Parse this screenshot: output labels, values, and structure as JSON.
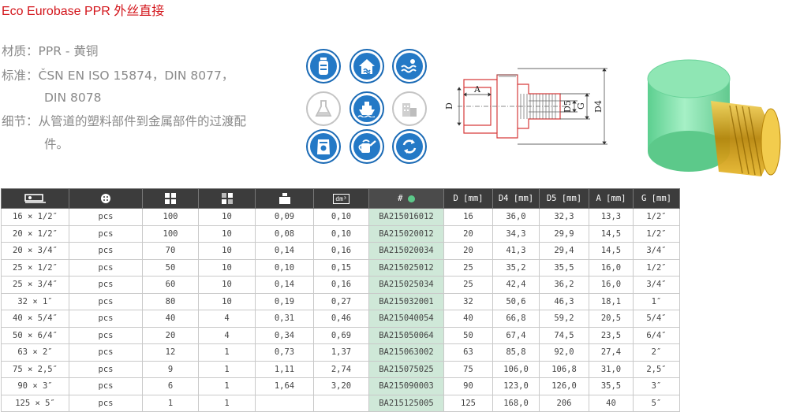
{
  "title": "Eco Eurobase PPR 外丝直接",
  "spec": {
    "material_label": "材质：",
    "material_value": "PPR - 黄铜",
    "standard_label": "标准：",
    "standard_value_1": "ČSN EN ISO 15874，DIN 8077，",
    "standard_value_2": "DIN 8078",
    "detail_label": "细节：",
    "detail_value_1": "从管道的塑料部件到金属部件的过渡配",
    "detail_value_2": "件。"
  },
  "application_icons": [
    {
      "name": "drinking-water-bottle-icon",
      "active": true
    },
    {
      "name": "house-heating-icon",
      "active": true
    },
    {
      "name": "swimming-pool-icon",
      "active": true
    },
    {
      "name": "chemistry-flask-icon",
      "active": false
    },
    {
      "name": "ship-icon",
      "active": true
    },
    {
      "name": "industrial-building-icon",
      "active": false
    },
    {
      "name": "fertilizer-bag-icon",
      "active": true
    },
    {
      "name": "watering-can-icon",
      "active": true
    },
    {
      "name": "recycling-arrows-icon",
      "active": true
    }
  ],
  "drawing_labels": {
    "d": "D",
    "a": "A",
    "d5": "D5",
    "g": "G",
    "d4": "D4"
  },
  "colors": {
    "title": "#d3151b",
    "header_bg": "#3c3c3c",
    "code_col": "#cfe8d8",
    "icon_blue": "#2479c6",
    "green_dot": "#5cc98a",
    "product_green": "#7ee0a8",
    "brass": "#d9a520"
  },
  "table": {
    "headers": [
      "size-icon",
      "pack-icon",
      "box-icon",
      "carton-icon",
      "weight-icon",
      "volume-icon",
      "#",
      "D [mm]",
      "D4 [mm]",
      "D5 [mm]",
      "A [mm]",
      "G [mm]"
    ],
    "header_text": {
      "code": "#",
      "d": "D [mm]",
      "d4": "D4 [mm]",
      "d5": "D5 [mm]",
      "a": "A [mm]",
      "g": "G [mm]",
      "dm3": "dm³"
    },
    "rows": [
      [
        "16 × 1/2″",
        "pcs",
        "100",
        "10",
        "0,09",
        "0,10",
        "BA215016012",
        "16",
        "36,0",
        "32,3",
        "13,3",
        "1/2″"
      ],
      [
        "20 × 1/2″",
        "pcs",
        "100",
        "10",
        "0,08",
        "0,10",
        "BA215020012",
        "20",
        "34,3",
        "29,9",
        "14,5",
        "1/2″"
      ],
      [
        "20 × 3/4″",
        "pcs",
        "70",
        "10",
        "0,14",
        "0,16",
        "BA215020034",
        "20",
        "41,3",
        "29,4",
        "14,5",
        "3/4″"
      ],
      [
        "25 × 1/2″",
        "pcs",
        "50",
        "10",
        "0,10",
        "0,15",
        "BA215025012",
        "25",
        "35,2",
        "35,5",
        "16,0",
        "1/2″"
      ],
      [
        "25 × 3/4″",
        "pcs",
        "60",
        "10",
        "0,14",
        "0,16",
        "BA215025034",
        "25",
        "42,4",
        "36,2",
        "16,0",
        "3/4″"
      ],
      [
        "32 × 1″",
        "pcs",
        "80",
        "10",
        "0,19",
        "0,27",
        "BA215032001",
        "32",
        "50,6",
        "46,3",
        "18,1",
        "1″"
      ],
      [
        "40 × 5/4″",
        "pcs",
        "40",
        "4",
        "0,31",
        "0,46",
        "BA215040054",
        "40",
        "66,8",
        "59,2",
        "20,5",
        "5/4″"
      ],
      [
        "50 × 6/4″",
        "pcs",
        "20",
        "4",
        "0,34",
        "0,69",
        "BA215050064",
        "50",
        "67,4",
        "74,5",
        "23,5",
        "6/4″"
      ],
      [
        "63 × 2″",
        "pcs",
        "12",
        "1",
        "0,73",
        "1,37",
        "BA215063002",
        "63",
        "85,8",
        "92,0",
        "27,4",
        "2″"
      ],
      [
        "75 × 2,5″",
        "pcs",
        "9",
        "1",
        "1,11",
        "2,74",
        "BA215075025",
        "75",
        "106,0",
        "106,8",
        "31,0",
        "2,5″"
      ],
      [
        "90 × 3″",
        "pcs",
        "6",
        "1",
        "1,64",
        "3,20",
        "BA215090003",
        "90",
        "123,0",
        "126,0",
        "35,5",
        "3″"
      ],
      [
        "125 × 5″",
        "pcs",
        "1",
        "1",
        "",
        "",
        "BA215125005",
        "125",
        "168,0",
        "206",
        "40",
        "5″"
      ]
    ]
  }
}
